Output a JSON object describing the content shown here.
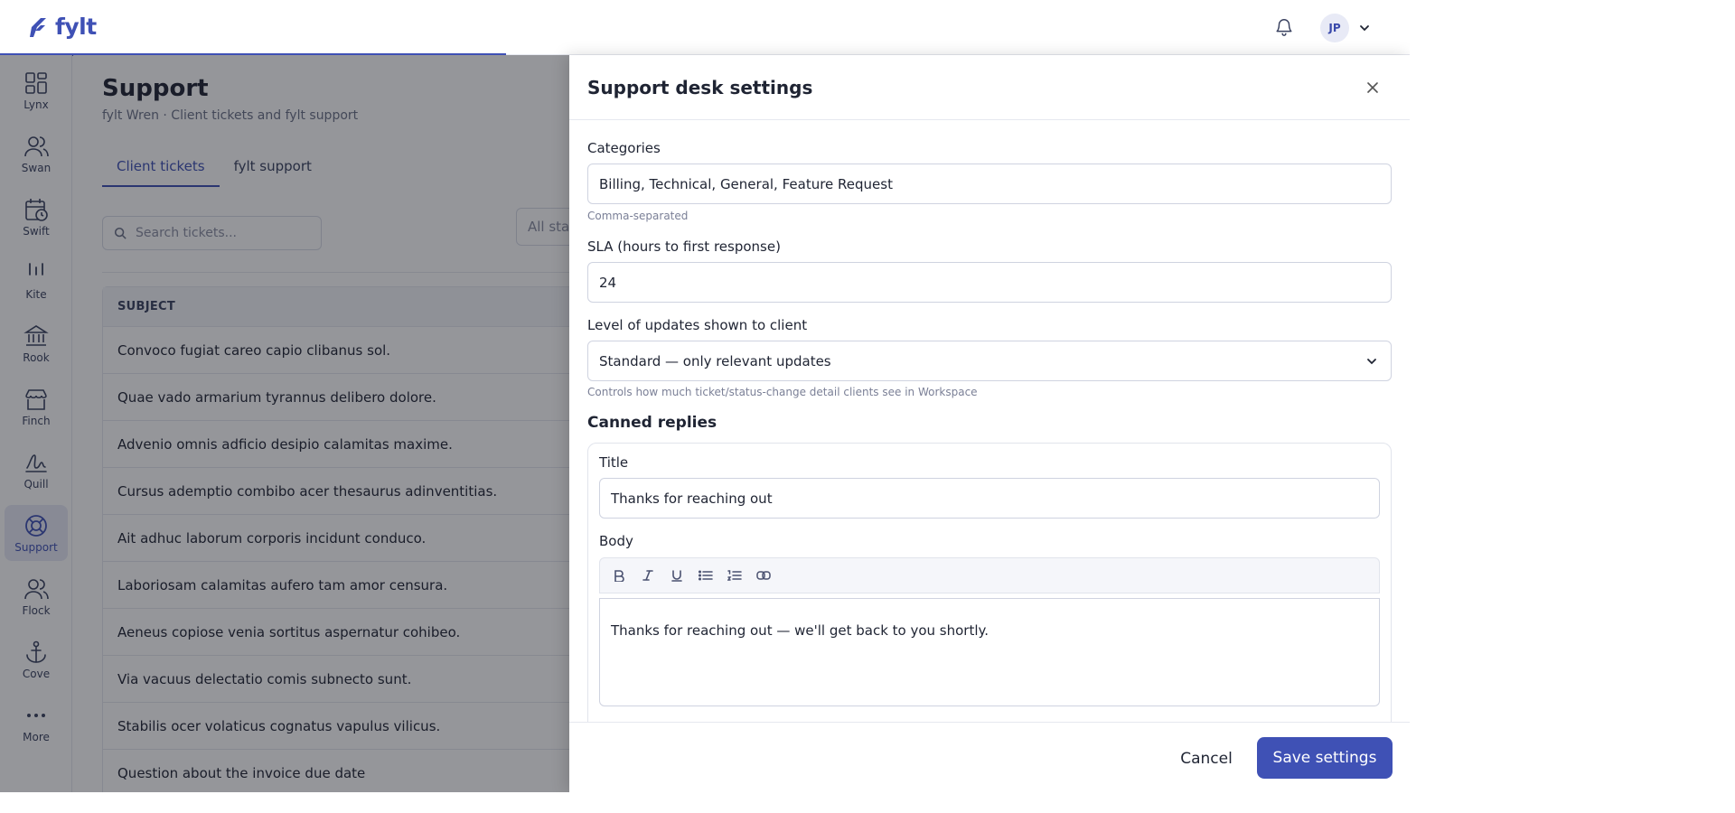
{
  "app": {
    "logo_text": "fylt",
    "user_initials": "JP"
  },
  "sidebar": {
    "items": [
      {
        "label": "Lynx",
        "icon": "grid-icon"
      },
      {
        "label": "Swan",
        "icon": "users-icon"
      },
      {
        "label": "Swift",
        "icon": "calendar-clock-icon"
      },
      {
        "label": "Kite",
        "icon": "bars-icon"
      },
      {
        "label": "Rook",
        "icon": "bank-icon"
      },
      {
        "label": "Finch",
        "icon": "store-icon"
      },
      {
        "label": "Quill",
        "icon": "signature-icon"
      },
      {
        "label": "Support",
        "icon": "lifebuoy-icon",
        "active": true
      },
      {
        "label": "Flock",
        "icon": "group-icon"
      },
      {
        "label": "Cove",
        "icon": "anchor-icon"
      },
      {
        "label": "More",
        "icon": "more-icon"
      }
    ]
  },
  "page": {
    "title": "Support",
    "subtitle": "fylt Wren · Client tickets and fylt support",
    "tabs": [
      "Client tickets",
      "fylt support"
    ],
    "search_placeholder": "Search tickets...",
    "status_filter": "All stat",
    "table": {
      "header": "SUBJECT",
      "rows": [
        "Convoco fugiat careo capio clibanus sol.",
        "Quae vado armarium tyrannus delibero dolore.",
        "Advenio omnis adficio desipio calamitas maxime.",
        "Cursus ademptio combibo acer thesaurus adinventitias.",
        "Ait adhuc laborum corporis incidunt conduco.",
        "Laboriosam calamitas aufero tam amor censura.",
        "Aeneus copiose venia sortitus aspernatur cohibeo.",
        "Via vacuus delectatio comis subnecto sunt.",
        "Stabilis ocer volaticus cognatus vapulus vilicus.",
        "Question about the invoice due date"
      ]
    }
  },
  "drawer": {
    "title": "Support desk settings",
    "categories": {
      "label": "Categories",
      "value": "Billing, Technical, General, Feature Request",
      "help": "Comma-separated"
    },
    "sla": {
      "label": "SLA (hours to first response)",
      "value": "24"
    },
    "updates_level": {
      "label": "Level of updates shown to client",
      "value": "Standard — only relevant updates",
      "help": "Controls how much ticket/status-change detail clients see in Workspace"
    },
    "canned": {
      "section_title": "Canned replies",
      "title_label": "Title",
      "title_value": "Thanks for reaching out",
      "body_label": "Body",
      "body_value": "Thanks for reaching out — we'll get back to you shortly."
    },
    "cancel_label": "Cancel",
    "save_label": "Save settings"
  },
  "colors": {
    "accent": "#3f51b5",
    "overlay": "rgba(20,22,32,0.45)"
  }
}
